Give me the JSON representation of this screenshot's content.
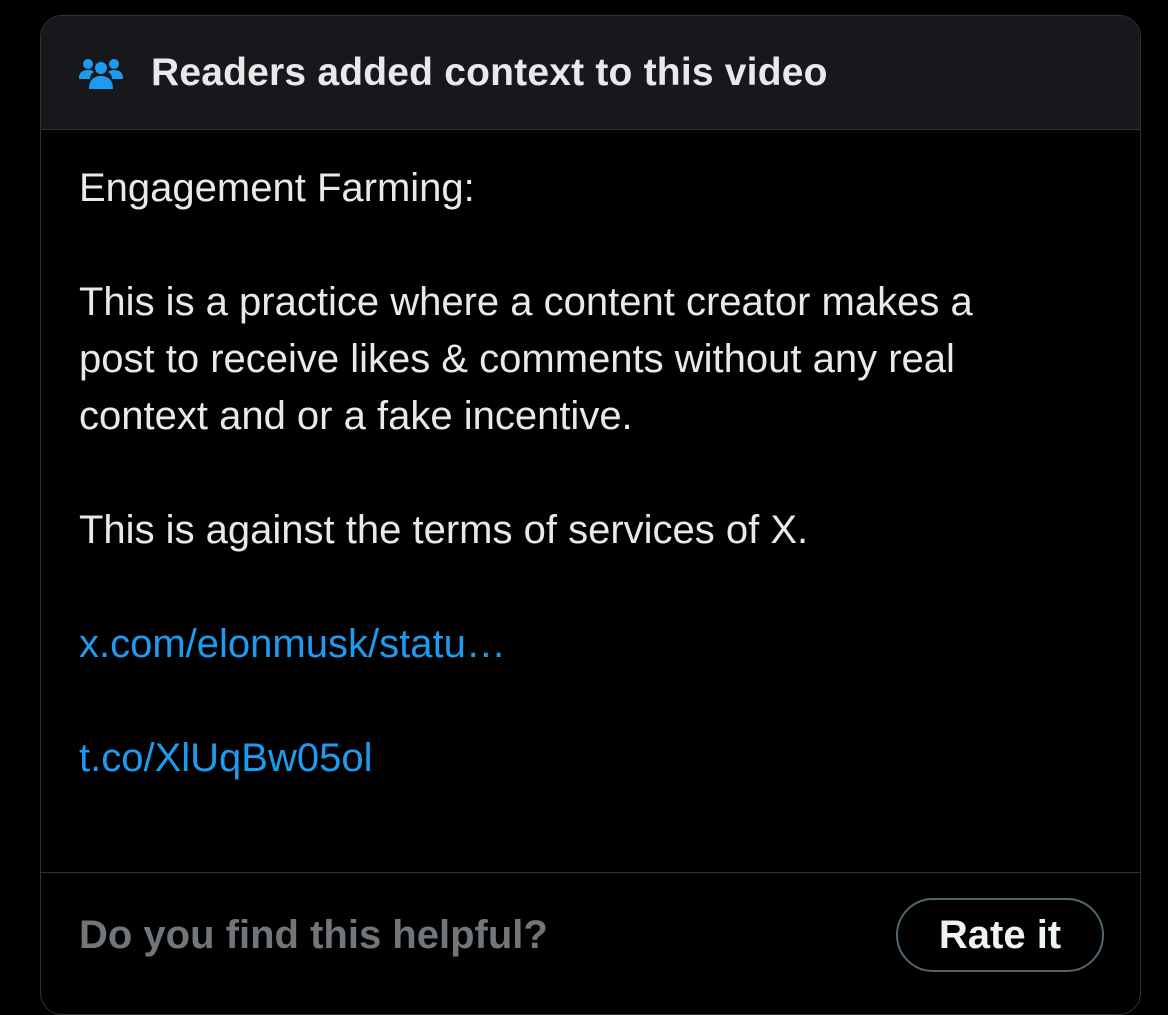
{
  "header": {
    "icon": "people-group-icon",
    "title": "Readers added context to this video"
  },
  "note": {
    "heading": "Engagement Farming:",
    "description": "This is a practice where a content creator makes a post to receive likes & comments without any real context and or a fake incentive.",
    "terms": "This is against the terms of services of X.",
    "links": [
      "x.com/elonmusk/statu…",
      "t.co/XlUqBw05ol"
    ]
  },
  "footer": {
    "question": "Do you find this helpful?",
    "rate_label": "Rate it"
  },
  "colors": {
    "accent": "#1d9bf0",
    "text": "#e7e9ea",
    "muted": "#71767b",
    "header_bg": "#16181c",
    "border": "#2f3336"
  }
}
